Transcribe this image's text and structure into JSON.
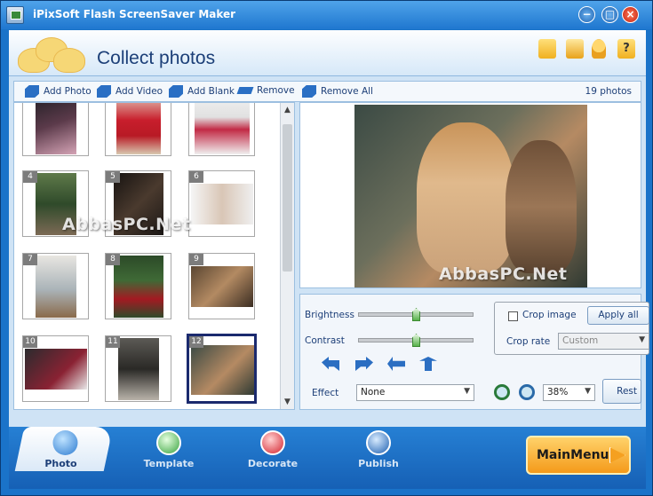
{
  "window": {
    "title": "iPixSoft Flash ScreenSaver Maker"
  },
  "header": {
    "title": "Collect photos",
    "icons": [
      "folder-icon",
      "save-icon",
      "user-icon",
      "help-icon"
    ],
    "help_glyph": "?"
  },
  "toolbar": {
    "add_photo": "Add Photo",
    "add_video": "Add Video",
    "add_blank": "Add Blank",
    "remove": "Remove",
    "remove_all": "Remove All",
    "count": "19 photos"
  },
  "thumbnails": [
    {
      "num": ""
    },
    {
      "num": ""
    },
    {
      "num": ""
    },
    {
      "num": "4"
    },
    {
      "num": "5"
    },
    {
      "num": "6"
    },
    {
      "num": "7"
    },
    {
      "num": "8"
    },
    {
      "num": "9"
    },
    {
      "num": "10"
    },
    {
      "num": "11"
    },
    {
      "num": "12",
      "selected": true
    }
  ],
  "watermark": "AbbasPC.Net",
  "controls": {
    "brightness_label": "Brightness",
    "brightness_value": 0.5,
    "contrast_label": "Contrast",
    "contrast_value": 0.5,
    "effect_label": "Effect",
    "effect_value": "None",
    "crop_image_label": "Crop image",
    "apply_all": "Apply all",
    "crop_rate_label": "Crop rate",
    "crop_rate_value": "Custom",
    "zoom_value": "38%",
    "reset_label": "Rest"
  },
  "nav": {
    "tabs": [
      {
        "label": "Photo",
        "active": true
      },
      {
        "label": "Template"
      },
      {
        "label": "Decorate"
      },
      {
        "label": "Publish"
      }
    ],
    "main_menu": "MainMenu"
  },
  "colors": {
    "accent": "#1a73c9",
    "title_blue": "#1c3f78",
    "main_menu": "#f49a1a"
  }
}
